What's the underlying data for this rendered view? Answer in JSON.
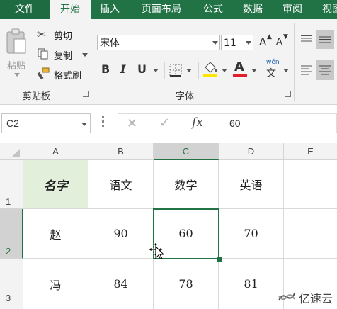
{
  "tabs": [
    {
      "label": "文件"
    },
    {
      "label": "开始"
    },
    {
      "label": "插入"
    },
    {
      "label": "页面布局"
    },
    {
      "label": "公式"
    },
    {
      "label": "数据"
    },
    {
      "label": "审阅"
    },
    {
      "label": "视图"
    }
  ],
  "ribbon": {
    "clipboard": {
      "paste": "粘贴",
      "cut": "剪切",
      "copy": "复制",
      "format_painter": "格式刷",
      "group_label": "剪贴板"
    },
    "font": {
      "font_name": "宋体",
      "font_size": "11",
      "grow": "A",
      "shrink": "A",
      "bold": "B",
      "italic": "I",
      "underline": "U",
      "font_color_letter": "A",
      "phonetic": "wén",
      "phonetic_char": "文",
      "group_label": "字体",
      "font_color": "#e0202a",
      "fill_color": "#ffe600"
    }
  },
  "formula_bar": {
    "name_box": "C2",
    "fx": "fx",
    "value": "60"
  },
  "grid": {
    "columns": [
      "A",
      "B",
      "C",
      "D",
      "E"
    ],
    "rows": [
      "1",
      "2",
      "3"
    ],
    "cells": {
      "A1": "名字",
      "B1": "语文",
      "C1": "数学",
      "D1": "英语",
      "A2": "赵",
      "B2": "90",
      "C2": "60",
      "D2": "70",
      "A3": "冯",
      "B3": "84",
      "C3": "78",
      "D3": "81"
    },
    "selected_cell": "C2",
    "header_fill": "#e2efda",
    "selection_color": "#217346"
  },
  "watermark": "亿速云"
}
